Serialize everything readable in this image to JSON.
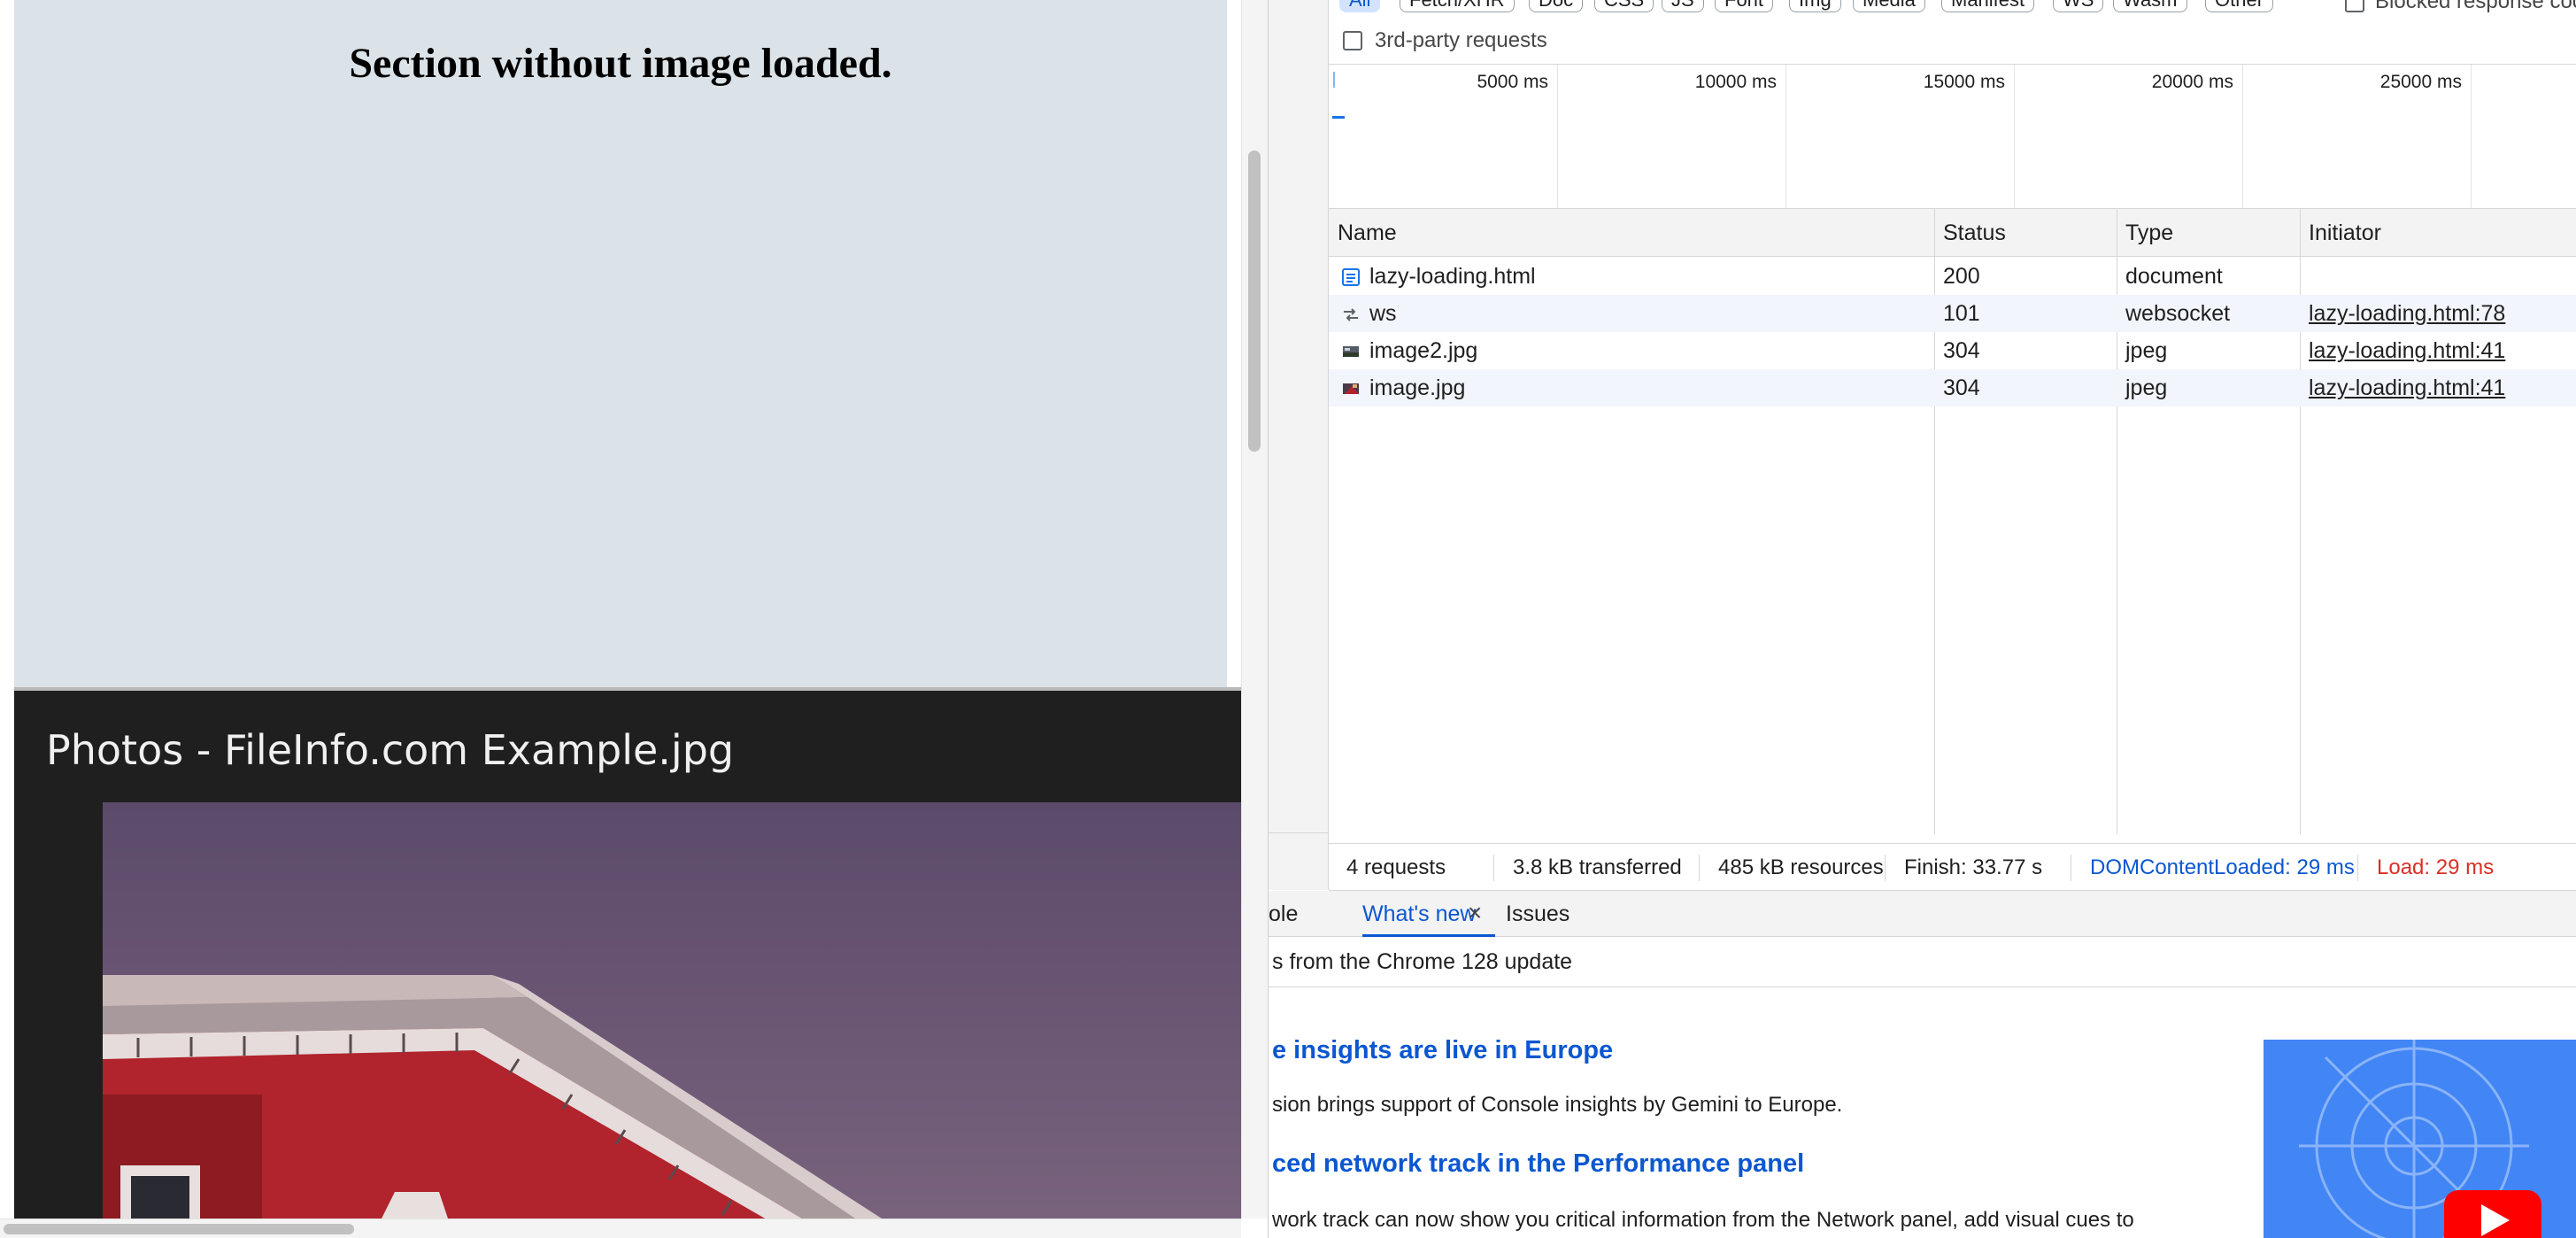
{
  "page": {
    "section_title": "Section without image loaded.",
    "photo_window_title": "Photos - FileInfo.com Example.jpg"
  },
  "devtools": {
    "filters": [
      "All",
      "Fetch/XHR",
      "Doc",
      "CSS",
      "JS",
      "Font",
      "Img",
      "Media",
      "Manifest",
      "WS",
      "Wasm",
      "Other"
    ],
    "blocked_cookies_label": "Blocked response cookies",
    "third_party_label": "3rd-party requests",
    "timeline_labels": [
      "5000 ms",
      "10000 ms",
      "15000 ms",
      "20000 ms",
      "25000 ms"
    ],
    "columns": {
      "name": "Name",
      "status": "Status",
      "type": "Type",
      "initiator": "Initiator"
    },
    "requests": [
      {
        "name": "lazy-loading.html",
        "status": "200",
        "type": "document",
        "initiator": "",
        "icon": "document-icon"
      },
      {
        "name": "ws",
        "status": "101",
        "type": "websocket",
        "initiator": "lazy-loading.html:78",
        "icon": "websocket-icon"
      },
      {
        "name": "image2.jpg",
        "status": "304",
        "type": "jpeg",
        "initiator": "lazy-loading.html:41",
        "icon": "image-icon"
      },
      {
        "name": "image.jpg",
        "status": "304",
        "type": "jpeg",
        "initiator": "lazy-loading.html:41",
        "icon": "image-icon"
      }
    ],
    "summary": {
      "requests": "4 requests",
      "transferred": "3.8 kB transferred",
      "resources": "485 kB resources",
      "finish": "Finish: 33.77 s",
      "dom_content_loaded": "DOMContentLoaded: 29 ms",
      "load": "Load: 29 ms"
    },
    "colors": {
      "accent": "#0b57d0",
      "load": "#d93025",
      "row_alt": "#f2f5fb"
    },
    "drawer": {
      "tabs": [
        "ole",
        "What's new",
        "Issues"
      ],
      "update_heading": "s from the Chrome 128 update",
      "news": [
        {
          "title": "e insights are live in Europe",
          "body": "sion brings support of Console insights by Gemini to Europe."
        },
        {
          "title": "ced network track in the Performance panel",
          "body": "work track can now show you critical information from the Network panel, add visual cues to"
        }
      ]
    }
  }
}
